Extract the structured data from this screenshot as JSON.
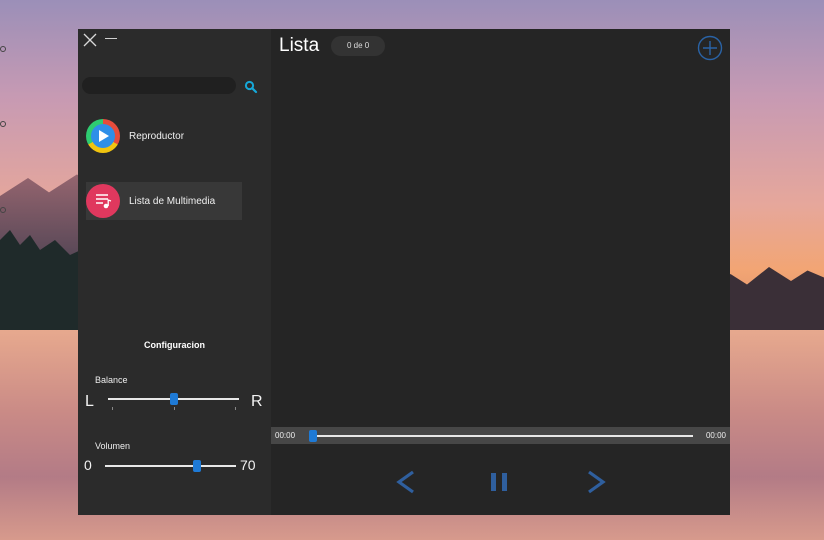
{
  "sidebar": {
    "search": {
      "value": "",
      "placeholder": ""
    },
    "nav": [
      {
        "label": "Reproductor",
        "icon": "play-circle-icon"
      },
      {
        "label": "Lista de Multimedia",
        "icon": "music-list-icon"
      }
    ],
    "active_nav": "Lista de Multimedia",
    "config": {
      "title": "Configuracion",
      "balance": {
        "label": "Balance",
        "left": "L",
        "right": "R",
        "value": 0.5
      },
      "volume": {
        "label": "Volumen",
        "min_label": "0",
        "value_label": "70",
        "value": 70
      }
    }
  },
  "main": {
    "title": "Lista",
    "count": "0 de 0",
    "player": {
      "current_time": "00:00",
      "total_time": "00:00",
      "progress": 0
    }
  },
  "colors": {
    "accent": "#1e7ad6",
    "window_bg": "#252525",
    "sidebar_bg": "#2b2b2b",
    "control_blue": "#2f5f9e",
    "search_icon": "#16a8d8"
  }
}
